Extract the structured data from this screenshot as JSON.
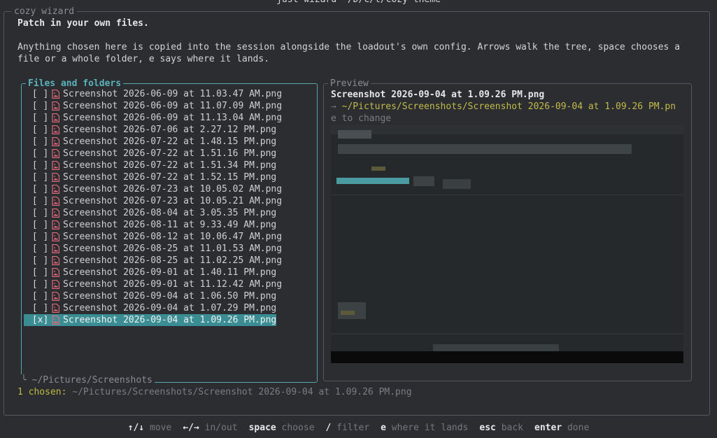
{
  "window": {
    "title": "just wizard ~/D/c/t/cozy-theme"
  },
  "wizard": {
    "legend": "cozy wizard",
    "heading": "Patch in your own files.",
    "description_line1": "Anything chosen here is copied into the session alongside the loadout's own config. Arrows walk the tree, space chooses a",
    "description_line2": "file or a whole folder, e says where it lands."
  },
  "files_panel": {
    "title": "Files and folders",
    "unchecked_mark": "[ ]",
    "checked_mark": "[x]",
    "items": [
      {
        "name": "Screenshot 2026-06-09 at 11.03.47 AM.png",
        "checked": false
      },
      {
        "name": "Screenshot 2026-06-09 at 11.07.09 AM.png",
        "checked": false
      },
      {
        "name": "Screenshot 2026-06-09 at 11.13.04 AM.png",
        "checked": false
      },
      {
        "name": "Screenshot 2026-07-06 at 2.27.12 PM.png",
        "checked": false
      },
      {
        "name": "Screenshot 2026-07-22 at 1.48.15 PM.png",
        "checked": false
      },
      {
        "name": "Screenshot 2026-07-22 at 1.51.16 PM.png",
        "checked": false
      },
      {
        "name": "Screenshot 2026-07-22 at 1.51.34 PM.png",
        "checked": false
      },
      {
        "name": "Screenshot 2026-07-22 at 1.52.15 PM.png",
        "checked": false
      },
      {
        "name": "Screenshot 2026-07-23 at 10.05.02 AM.png",
        "checked": false
      },
      {
        "name": "Screenshot 2026-07-23 at 10.05.21 AM.png",
        "checked": false
      },
      {
        "name": "Screenshot 2026-08-04 at 3.05.35 PM.png",
        "checked": false
      },
      {
        "name": "Screenshot 2026-08-11 at 9.33.49 AM.png",
        "checked": false
      },
      {
        "name": "Screenshot 2026-08-12 at 10.06.47 AM.png",
        "checked": false
      },
      {
        "name": "Screenshot 2026-08-25 at 11.01.53 AM.png",
        "checked": false
      },
      {
        "name": "Screenshot 2026-08-25 at 11.02.25 AM.png",
        "checked": false
      },
      {
        "name": "Screenshot 2026-09-01 at 1.40.11 PM.png",
        "checked": false
      },
      {
        "name": "Screenshot 2026-09-01 at 11.12.42 AM.png",
        "checked": false
      },
      {
        "name": "Screenshot 2026-09-04 at 1.06.50 PM.png",
        "checked": false
      },
      {
        "name": "Screenshot 2026-09-04 at 1.07.29 PM.png",
        "checked": false
      },
      {
        "name": "Screenshot 2026-09-04 at 1.09.26 PM.png",
        "checked": true,
        "selected": true
      }
    ],
    "current_dir": "~/Pictures/Screenshots",
    "file_icon": "image-file-icon"
  },
  "preview_panel": {
    "title": "Preview",
    "filename": "Screenshot 2026-09-04 at 1.09.26 PM.png",
    "arrow": "→",
    "destination": "~/Pictures/Screenshots/Screenshot 2026-09-04 at 1.09.26 PM.pn",
    "change_hint": "e to change"
  },
  "status": {
    "chosen_label": "1 chosen:",
    "chosen_path": "~/Pictures/Screenshots/Screenshot 2026-09-04 at 1.09.26 PM.png"
  },
  "footer": {
    "hints": [
      {
        "key": "↑/↓",
        "desc": "move"
      },
      {
        "key": "←/→",
        "desc": "in/out"
      },
      {
        "key": "space",
        "desc": "choose"
      },
      {
        "key": "/",
        "desc": "filter"
      },
      {
        "key": "e",
        "desc": "where it lands"
      },
      {
        "key": "esc",
        "desc": "back"
      },
      {
        "key": "enter",
        "desc": "done"
      }
    ]
  },
  "colors": {
    "background": "#2b2d31",
    "accent": "#5ab3bb",
    "selection": "#3b8d94",
    "chosen": "#c0ba45",
    "file_icon": "#e06b7a"
  }
}
